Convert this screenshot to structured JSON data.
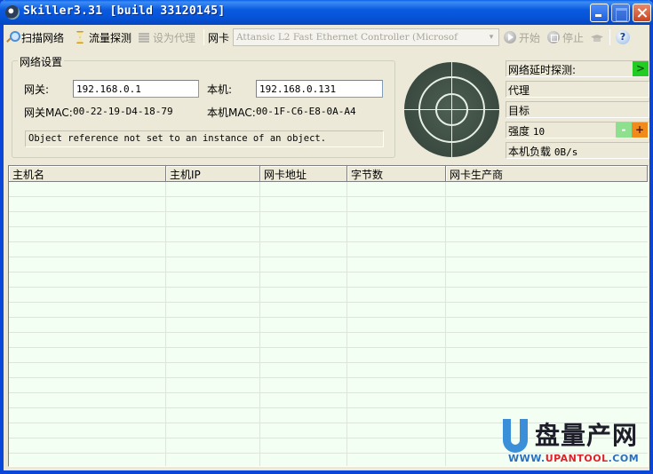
{
  "window": {
    "title": "Skiller3.31 [build 33120145]",
    "controls": {
      "minimize": "minimize",
      "maximize": "maximize",
      "close": "close"
    }
  },
  "toolbar": {
    "scan_network": "扫描网络",
    "traffic_detect": "流量探测",
    "set_proxy": "设为代理",
    "nic_label": "网卡",
    "nic_selected": "Attansic L2 Fast Ethernet Controller (Microsof",
    "nic_arrow": "▾",
    "start": "开始",
    "stop": "停止"
  },
  "network_settings": {
    "legend": "网络设置",
    "gateway_label": "网关:",
    "gateway_ip": "192.168.0.1",
    "local_label": "本机:",
    "local_ip": "192.168.0.131",
    "gateway_mac_label": "网关MAC:",
    "gateway_mac": "00-22-19-D4-18-79",
    "local_mac_label": "本机MAC:",
    "local_mac": "00-1F-C6-E8-0A-A4",
    "status_message": "Object reference not set to an instance of an object."
  },
  "info_panel": {
    "latency_probe": "网络延时探测:",
    "latency_go": ">",
    "proxy": "代理",
    "target": "目标",
    "strength_label": "强度",
    "strength_value": "10",
    "minus": "-",
    "plus": "+",
    "load_label": "本机负载",
    "load_value": "0B/s"
  },
  "table": {
    "columns": [
      "主机名",
      "主机IP",
      "网卡地址",
      "字节数",
      "网卡生产商"
    ],
    "rows": []
  },
  "watermark": {
    "brand": "盘量产网",
    "url_prefix": "WWW.",
    "url_main": "UPANTOOL",
    "url_suffix": ".COM"
  }
}
